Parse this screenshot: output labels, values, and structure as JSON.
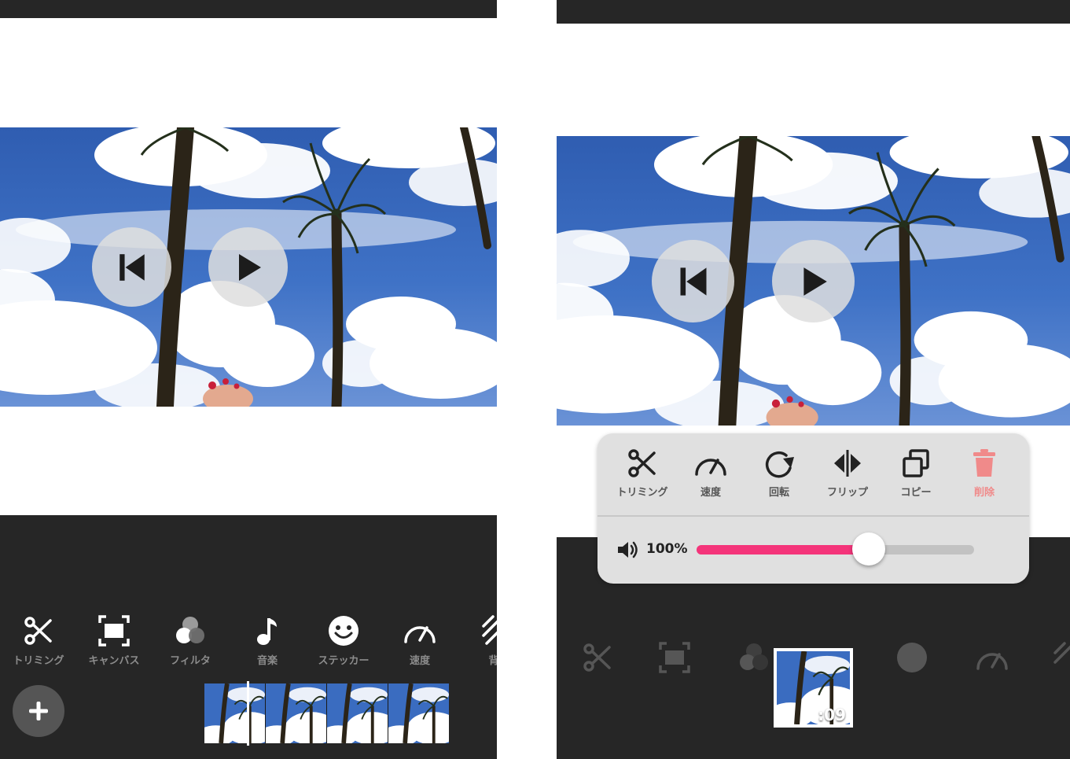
{
  "left_screen": {
    "toolbar": [
      {
        "label": "トリミング",
        "icon": "scissors-icon"
      },
      {
        "label": "キャンバス",
        "icon": "canvas-icon"
      },
      {
        "label": "フィルタ",
        "icon": "filter-icon"
      },
      {
        "label": "音楽",
        "icon": "music-note-icon"
      },
      {
        "label": "ステッカー",
        "icon": "smiley-icon"
      },
      {
        "label": "速度",
        "icon": "speedometer-icon"
      },
      {
        "label": "背",
        "icon": "background-icon"
      }
    ],
    "add_button_icon": "plus-icon"
  },
  "right_screen": {
    "edit_panel": {
      "tools": [
        {
          "label": "トリミング",
          "icon": "scissors-icon"
        },
        {
          "label": "速度",
          "icon": "speedometer-icon"
        },
        {
          "label": "回転",
          "icon": "rotate-icon"
        },
        {
          "label": "フリップ",
          "icon": "flip-icon"
        },
        {
          "label": "コピー",
          "icon": "copy-icon"
        },
        {
          "label": "削除",
          "icon": "trash-icon"
        }
      ],
      "volume": {
        "label": "100%",
        "level": 0.62
      }
    },
    "clip": {
      "duration": ":09"
    }
  },
  "colors": {
    "dark_bg": "#262626",
    "accent_pink": "#f4347a",
    "delete_red": "#f08a8a",
    "panel_bg": "#e0e0e0",
    "tool_label": "#8c8c8c"
  }
}
